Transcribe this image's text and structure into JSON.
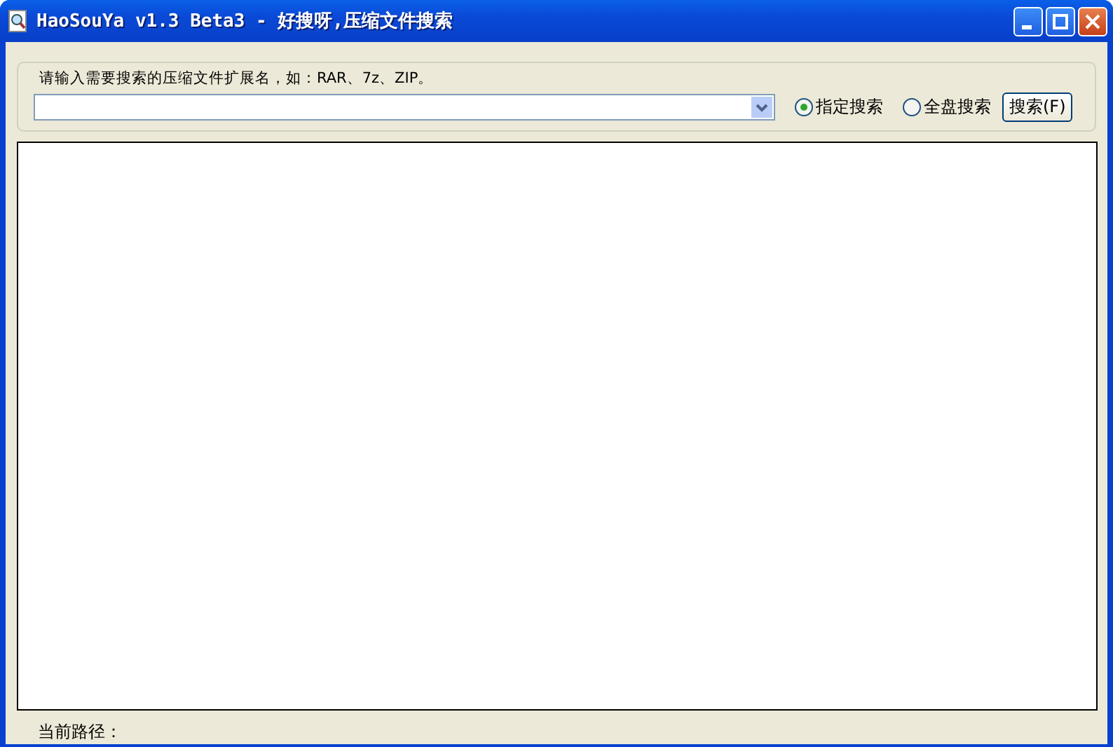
{
  "window": {
    "title": "HaoSouYa v1.3 Beta3 - 好搜呀,压缩文件搜索"
  },
  "search": {
    "label": "请输入需要搜索的压缩文件扩展名，如：RAR、7z、ZIP。"
  },
  "scope_options": [
    {
      "label": "指定搜索",
      "selected": true
    },
    {
      "label": "全盘搜索",
      "selected": false
    }
  ],
  "search_button": "搜索(F)",
  "status_bar": {
    "label": "当前路径："
  }
}
